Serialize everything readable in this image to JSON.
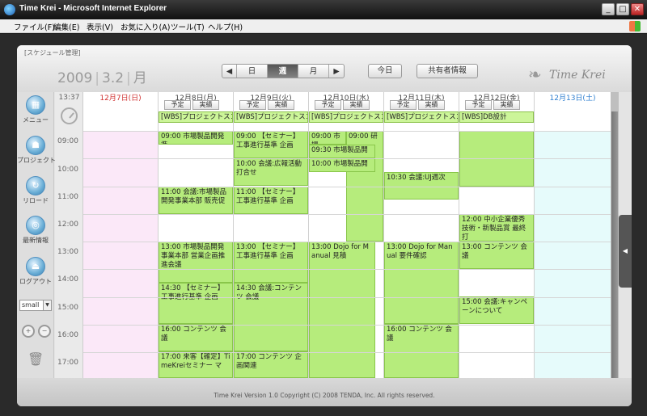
{
  "window": {
    "title": "Time Krei - Microsoft Internet Explorer",
    "min": "_",
    "max": "□",
    "close": "✕"
  },
  "menu": [
    "ファイル(F)",
    "編集(E)",
    "表示(V)",
    "お気に入り(A)",
    "ツール(T)",
    "ヘルプ(H)"
  ],
  "app": {
    "breadcrumb": "[スケジュール管理]",
    "year": "2009",
    "md": "3.2",
    "dow": "月",
    "nav": {
      "prev": "◀",
      "day": "日",
      "week": "週",
      "month": "月",
      "next": "▶"
    },
    "today": "今日",
    "shared": "共有者情報",
    "brand": "Time Krei",
    "footer": "Time Krei Version 1.0        Copyright (C) 2008 TENDA, Inc. All rights reserved."
  },
  "sidebar": {
    "menu": "メニュー",
    "project": "プロジェクト",
    "reload": "リロード",
    "latest": "最新情報",
    "logout": "ログアウト",
    "size": "small"
  },
  "calendar": {
    "now": "13:37",
    "plan": "予定",
    "actual": "実績",
    "hours": [
      "09:00",
      "10:00",
      "11:00",
      "12:00",
      "13:00",
      "14:00",
      "15:00",
      "16:00",
      "17:00"
    ],
    "days": [
      {
        "label": "12月7日(日)",
        "color": "#d03030",
        "bg": "#fbe8f8",
        "allday": ""
      },
      {
        "label": "12月8日(月)",
        "color": "#444444",
        "bg": "#ffffff",
        "allday": "[WBS]プロジェクトスコ"
      },
      {
        "label": "12月9日(火)",
        "color": "#444444",
        "bg": "#ffffff",
        "allday": "[WBS]プロジェクトスコ"
      },
      {
        "label": "12月10日(水)",
        "color": "#444444",
        "bg": "#ffffff",
        "allday": "[WBS]プロジェクトスコ"
      },
      {
        "label": "12月11日(木)",
        "color": "#444444",
        "bg": "#ffffff",
        "allday": "[WBS]プロジェクトスコ"
      },
      {
        "label": "12月12日(金)",
        "color": "#444444",
        "bg": "#ffffff",
        "allday": "[WBS]DB設計"
      },
      {
        "label": "12月13日(土)",
        "color": "#2f7fd0",
        "bg": "#e6fbfb",
        "allday": ""
      }
    ],
    "events": {
      "d1": [
        "09:00 市場製品開発準",
        "11:00 会議:市場製品開発事業本部 販売促",
        "13:00 市場製品開発事業本部 営業企画推進会議",
        "14:30 【セミナー】工事進行基準 企画",
        "16:00 コンテンツ 会議",
        "17:00 来客【確定】TimeKreiセミナー マ"
      ],
      "d2": [
        "09:00 【セミナー】工事進行基準 企画",
        "10:00 会議:広報活動打合せ",
        "11:00 【セミナー】工事進行基準 企画",
        "13:00 【セミナー】工事進行基準 企画",
        "14:30 会議:コンテンツ 会議",
        "17:00 コンテンツ 企画関連"
      ],
      "d3": [
        "09:00 市場",
        "09:00 研",
        "09:30 市場製品開",
        "10:00 市場製品開",
        "13:00 Dojo for Manual 見積"
      ],
      "d4": [
        "10:30 会議:UJ週次",
        "13:00 Dojo for Manual 要件確認",
        "16:00 コンテンツ 会議"
      ],
      "d5": [
        "12:00 中小企業優秀技術・新製品賞 最終打",
        "13:00 コンテンツ 会議",
        "15:00 会議:キャンペーンについて"
      ]
    }
  }
}
